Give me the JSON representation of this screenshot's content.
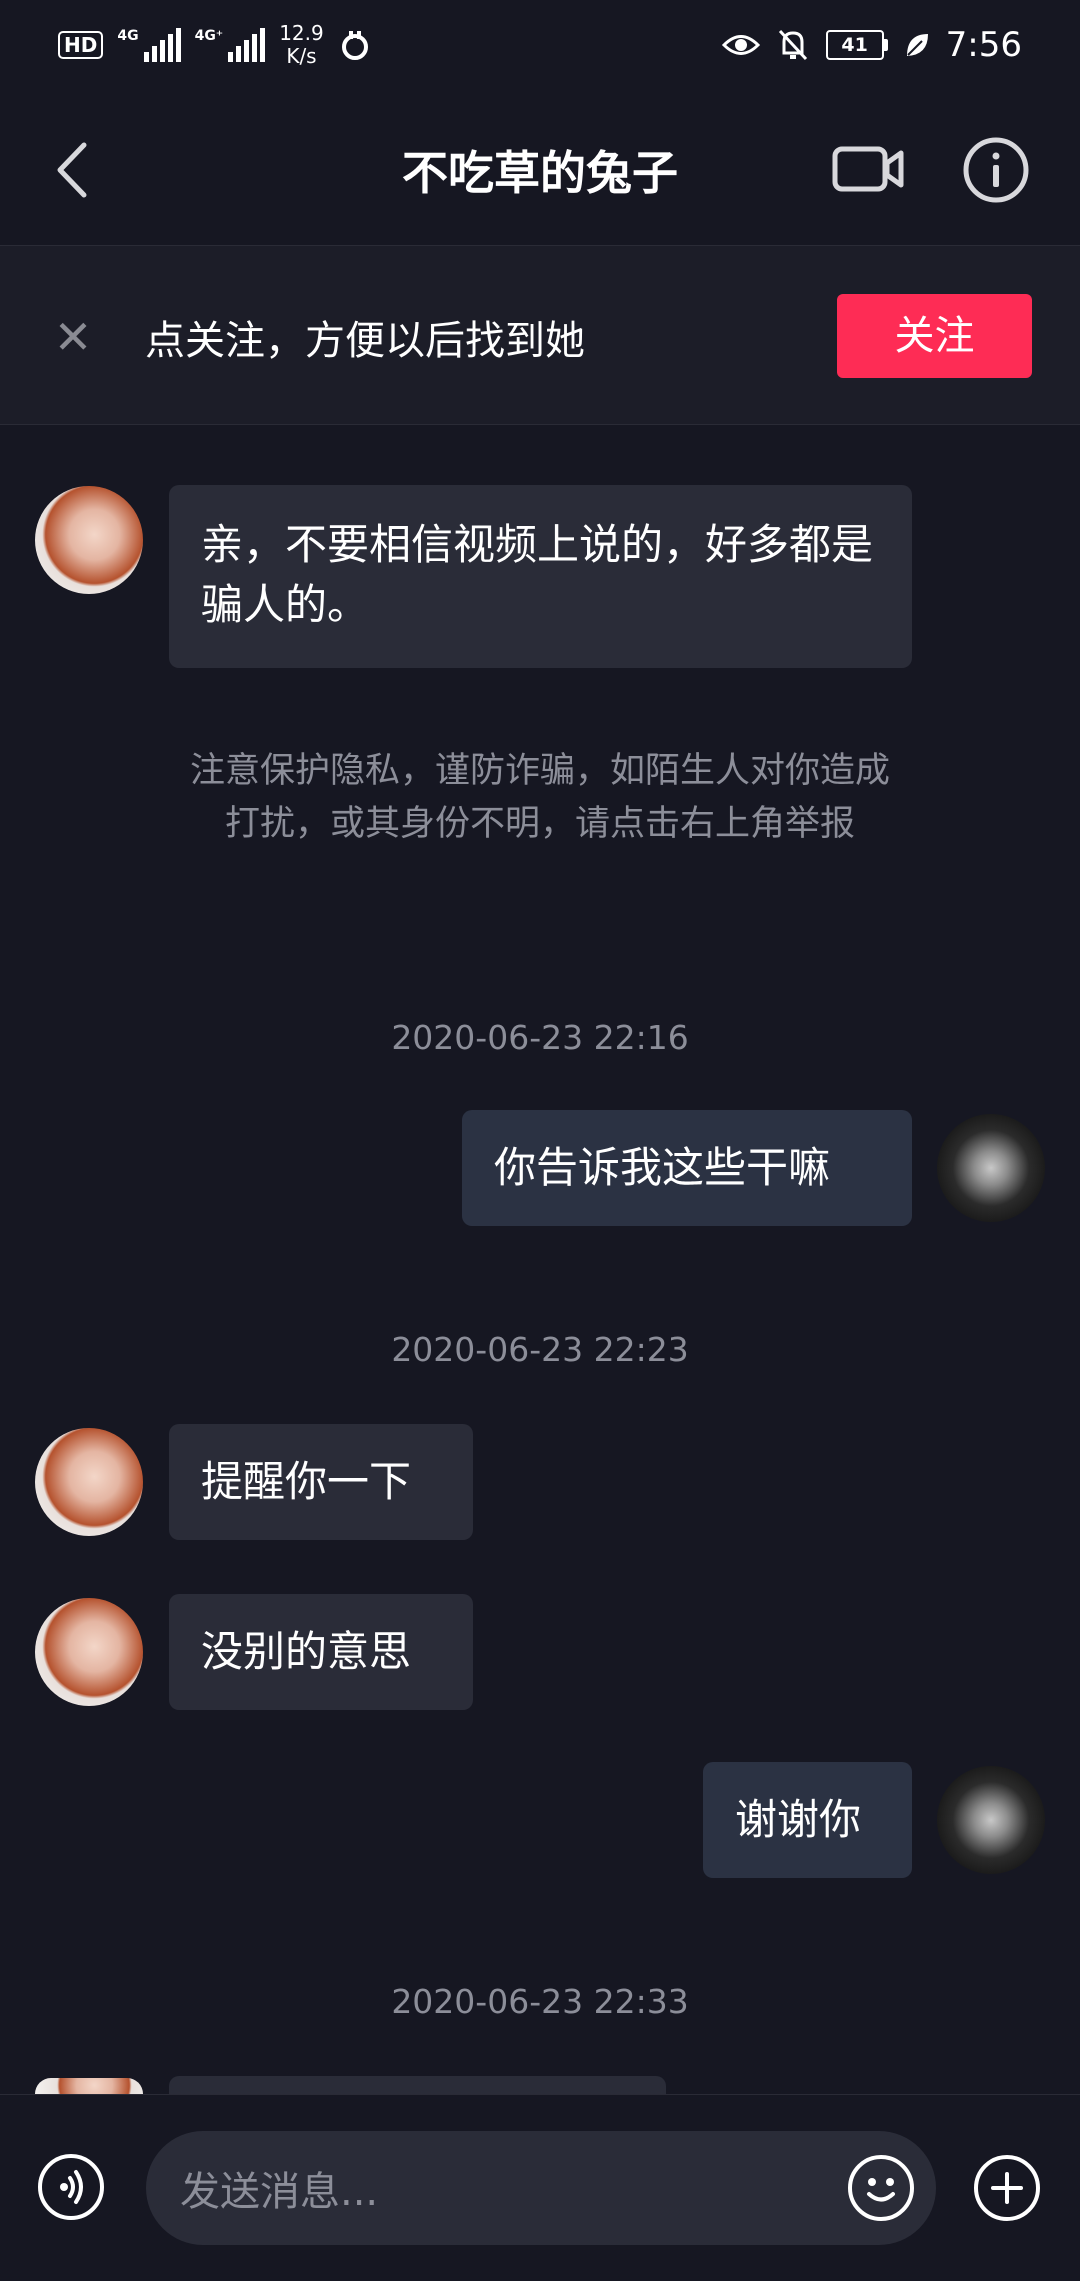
{
  "status_bar": {
    "hd": "HD",
    "sim1_tag": "4G",
    "sim2_tag": "4G⁺",
    "net_speed_value": "12.9",
    "net_speed_unit": "K/s",
    "battery": "41",
    "time": "7:56",
    "icons": [
      "tiktok-icon",
      "eye-icon",
      "mute-bell-icon",
      "leaf-icon"
    ]
  },
  "header": {
    "title": "不吃草的兔子",
    "icons": [
      "back-icon",
      "video-call-icon",
      "info-icon"
    ]
  },
  "follow_bar": {
    "text": "点关注，方便以后找到她",
    "button": "关注",
    "accent": "#fe2c55"
  },
  "notice": "注意保护隐私，谨防诈骗，如陌生人对你造成打扰，或其身份不明，请点击右上角举报",
  "messages": {
    "m1": "亲，不要相信视频上说的，好多都是骗人的。",
    "t1": "2020-06-23 22:16",
    "m2": "你告诉我这些干嘛",
    "t2": "2020-06-23 22:23",
    "m3": "提醒你一下",
    "m4": "没别的意思",
    "m5": "谢谢你",
    "t3": "2020-06-23 22:33"
  },
  "input_bar": {
    "placeholder": "发送消息...",
    "icons": [
      "voice-icon",
      "emoji-icon",
      "plus-icon"
    ]
  },
  "colors": {
    "background": "#161722",
    "bubble_other": "#2a2c38",
    "bubble_self": "#2b3243",
    "muted_text": "#8c8e99"
  }
}
